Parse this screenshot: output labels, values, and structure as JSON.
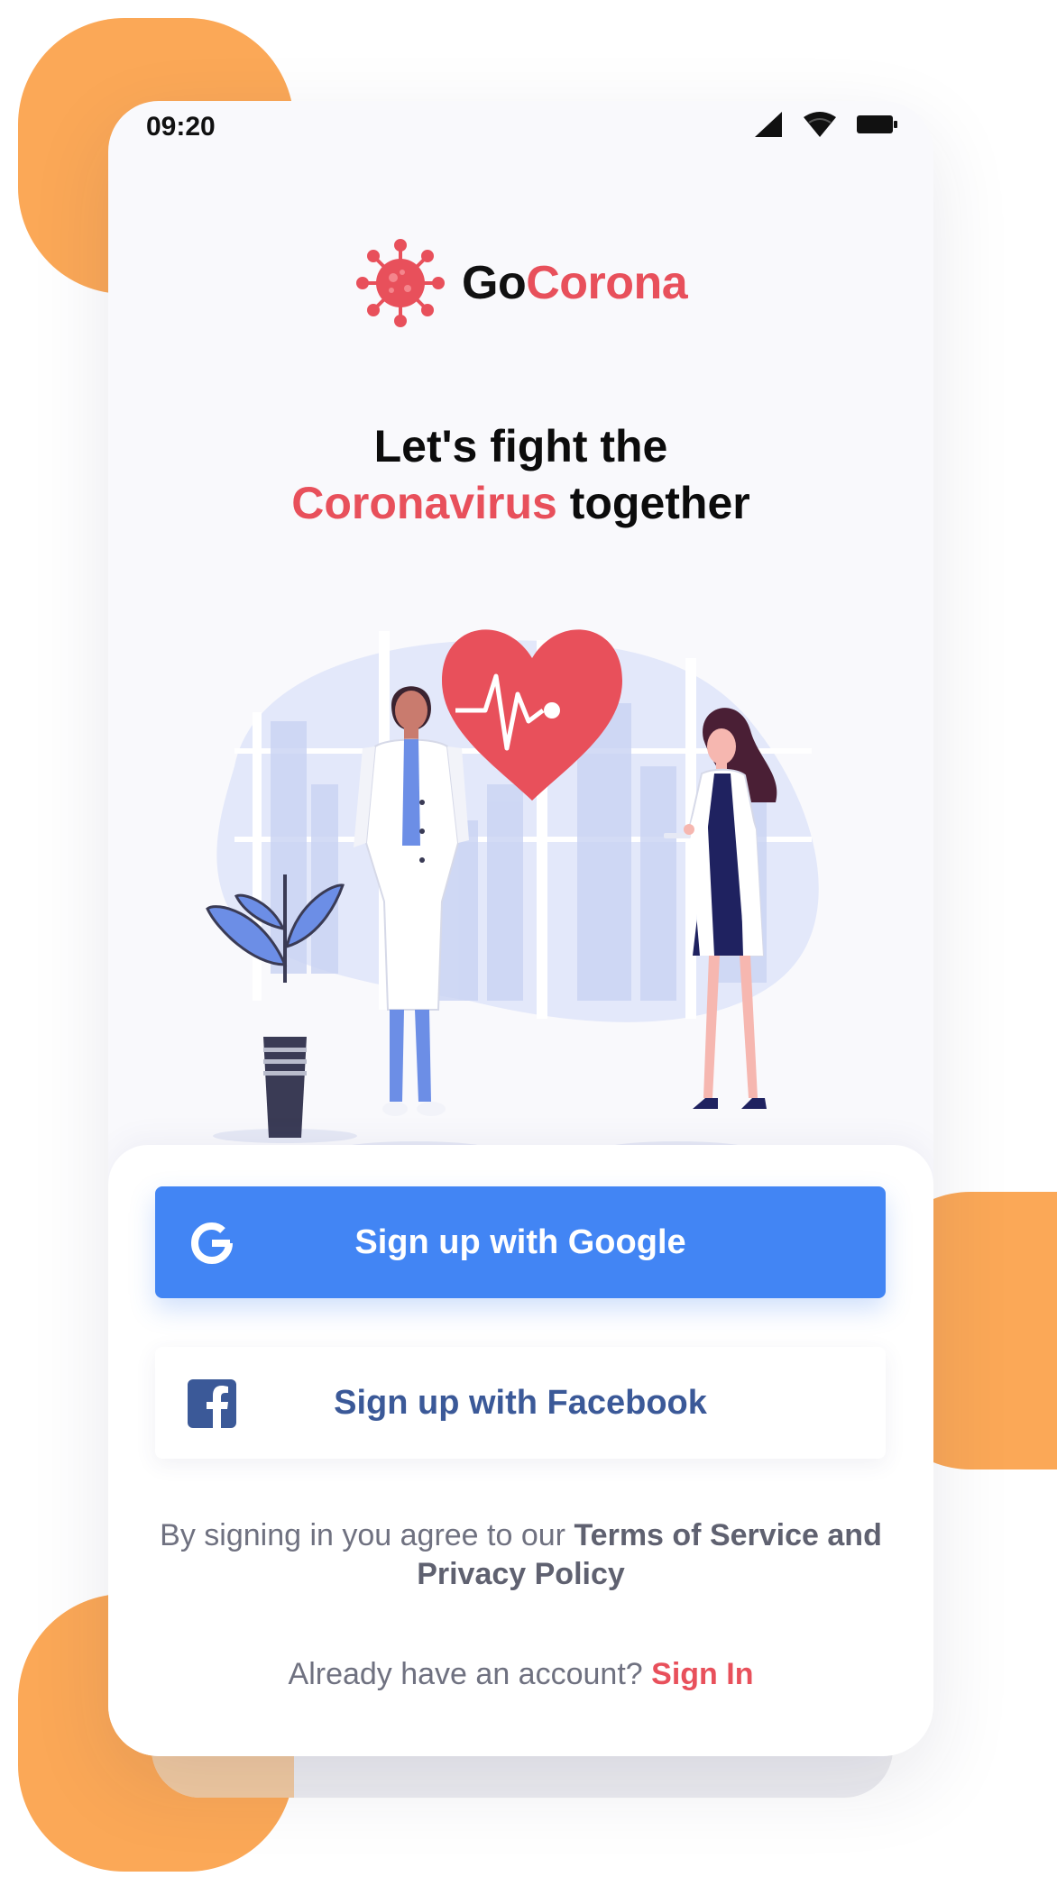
{
  "status_bar": {
    "time": "09:20",
    "icons": [
      "cellular-signal-icon",
      "wifi-icon",
      "battery-icon"
    ]
  },
  "brand": {
    "logo_icon": "virus-icon",
    "name_part1": "Go",
    "name_part2": "Corona"
  },
  "headline": {
    "line1": "Let's fight the",
    "line2_accent": "Coronavirus",
    "line2_rest": "together"
  },
  "illustration": {
    "icon": "doctors-heart-illustration"
  },
  "actions": {
    "google_label": "Sign up with Google",
    "google_icon": "google-icon",
    "facebook_label": "Sign up with Facebook",
    "facebook_icon": "facebook-icon"
  },
  "terms": {
    "prefix": "By signing in you agree to our",
    "link": "Terms of Service and Privacy Policy"
  },
  "signin": {
    "prompt": "Already have an account?",
    "link": "Sign In"
  },
  "colors": {
    "accent": "#E8505B",
    "google_blue": "#4285F4",
    "facebook_blue": "#3B5998",
    "decor_orange": "#FBA857",
    "illustration_blue": "#6C8EE6"
  }
}
